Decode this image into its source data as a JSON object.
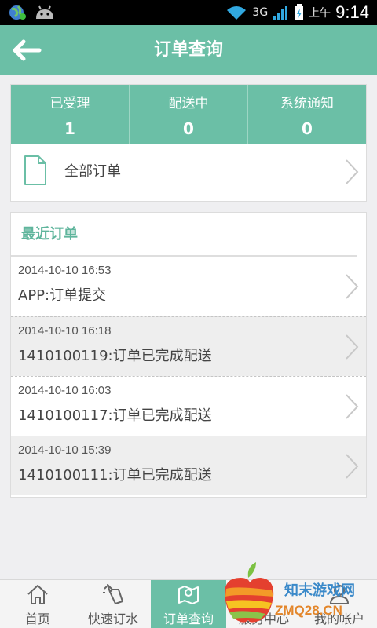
{
  "status_bar": {
    "network_label": "3G",
    "time_period": "上午",
    "clock": "9:14"
  },
  "header": {
    "title": "订单查询"
  },
  "stats": [
    {
      "label": "已受理",
      "count": "1"
    },
    {
      "label": "配送中",
      "count": "0"
    },
    {
      "label": "系统通知",
      "count": "0"
    }
  ],
  "all_orders": {
    "label": "全部订单"
  },
  "recent": {
    "title": "最近订单",
    "orders": [
      {
        "time": "2014-10-10 16:53",
        "desc": "APP:订单提交"
      },
      {
        "time": "2014-10-10 16:18",
        "desc": "1410100119:订单已完成配送"
      },
      {
        "time": "2014-10-10 16:03",
        "desc": "1410100117:订单已完成配送"
      },
      {
        "time": "2014-10-10 15:39",
        "desc": "1410100111:订单已完成配送"
      }
    ]
  },
  "nav": {
    "items": [
      {
        "label": "首页",
        "icon": "home-icon"
      },
      {
        "label": "快速订水",
        "icon": "water-bottle-icon"
      },
      {
        "label": "订单查询",
        "icon": "map-pin-icon",
        "active": true
      },
      {
        "label": "服务中心",
        "icon": "service-icon"
      },
      {
        "label": "我的帐户",
        "icon": "user-icon"
      }
    ]
  },
  "watermark": {
    "brand": "知末游戏网",
    "domain": "ZMQ28.CN"
  },
  "colors": {
    "accent": "#6bbfa6",
    "accent_text": "#5fb59c",
    "background": "#efeff1"
  }
}
